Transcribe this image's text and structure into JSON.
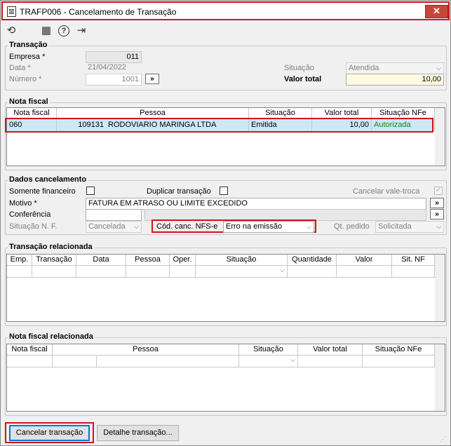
{
  "window": {
    "title": "TRAFP006 - Cancelamento de Transação",
    "close_glyph": "✕"
  },
  "toolbar": {
    "icons": [
      "undo-icon",
      "calendar-icon",
      "help-icon",
      "exit-icon"
    ],
    "undo_glyph": "⟲",
    "calendar_glyph": "▦",
    "help_glyph": "?",
    "exit_glyph": "⇥"
  },
  "transacao": {
    "legend": "Transação",
    "empresa_label": "Empresa *",
    "empresa_value": "011",
    "data_label": "Data *",
    "data_value": "21/04/2022",
    "numero_label": "Número *",
    "numero_value": "1001",
    "situacao_label": "Situação",
    "situacao_value": "Atendida",
    "valor_total_label": "Valor total",
    "valor_total_value": "10,00",
    "lookup_glyph": "»"
  },
  "nota_fiscal": {
    "legend": "Nota fiscal",
    "columns": [
      "Nota fiscal",
      "Pessoa",
      "Situação",
      "Valor total",
      "Situação NFe"
    ],
    "row": {
      "nota": "060",
      "pessoa_codigo": "109131",
      "pessoa_nome": "RODOVIARIO MARINGA LTDA",
      "situacao": "Emitida",
      "valor_total": "10,00",
      "situacao_nfe": "Autorizada"
    },
    "colors": {
      "row_bg": "#cce8f6",
      "autorizada": "#118811"
    }
  },
  "dados_cancelamento": {
    "legend": "Dados cancelamento",
    "somente_financeiro_label": "Somente financeiro",
    "duplicar_label": "Duplicar transação",
    "cancelar_vale_label": "Cancelar vale-troca",
    "motivo_label": "Motivo *",
    "motivo_value": "FATURA EM ATRASO OU LIMITE EXCEDIDO",
    "conferencia_label": "Conferência",
    "conferencia_value": "",
    "situacao_nf_label": "Situação N. F.",
    "situacao_nf_value": "Cancelada",
    "cod_canc_label": "Cód. canc. NFS-e",
    "cod_canc_value": "Erro na emissão",
    "qt_pedido_label": "Qt. pedido",
    "qt_pedido_value": "Solicitada",
    "lookup_glyph": "»"
  },
  "transacao_relacionada": {
    "legend": "Transação relacionada",
    "columns": [
      "Emp.",
      "Transação",
      "Data",
      "Pessoa",
      "Oper.",
      "Situação",
      "Quantidade",
      "Valor",
      "Sit. NF"
    ]
  },
  "nota_fiscal_relacionada": {
    "legend": "Nota fiscal relacionada",
    "columns": [
      "Nota fiscal",
      "Pessoa",
      "Situação",
      "Valor total",
      "Situação NFe"
    ]
  },
  "buttons": {
    "cancelar": "Cancelar transação",
    "detalhe": "Detalhe transação..."
  },
  "check_glyph": "✓",
  "chevron_glyph": "⌵"
}
